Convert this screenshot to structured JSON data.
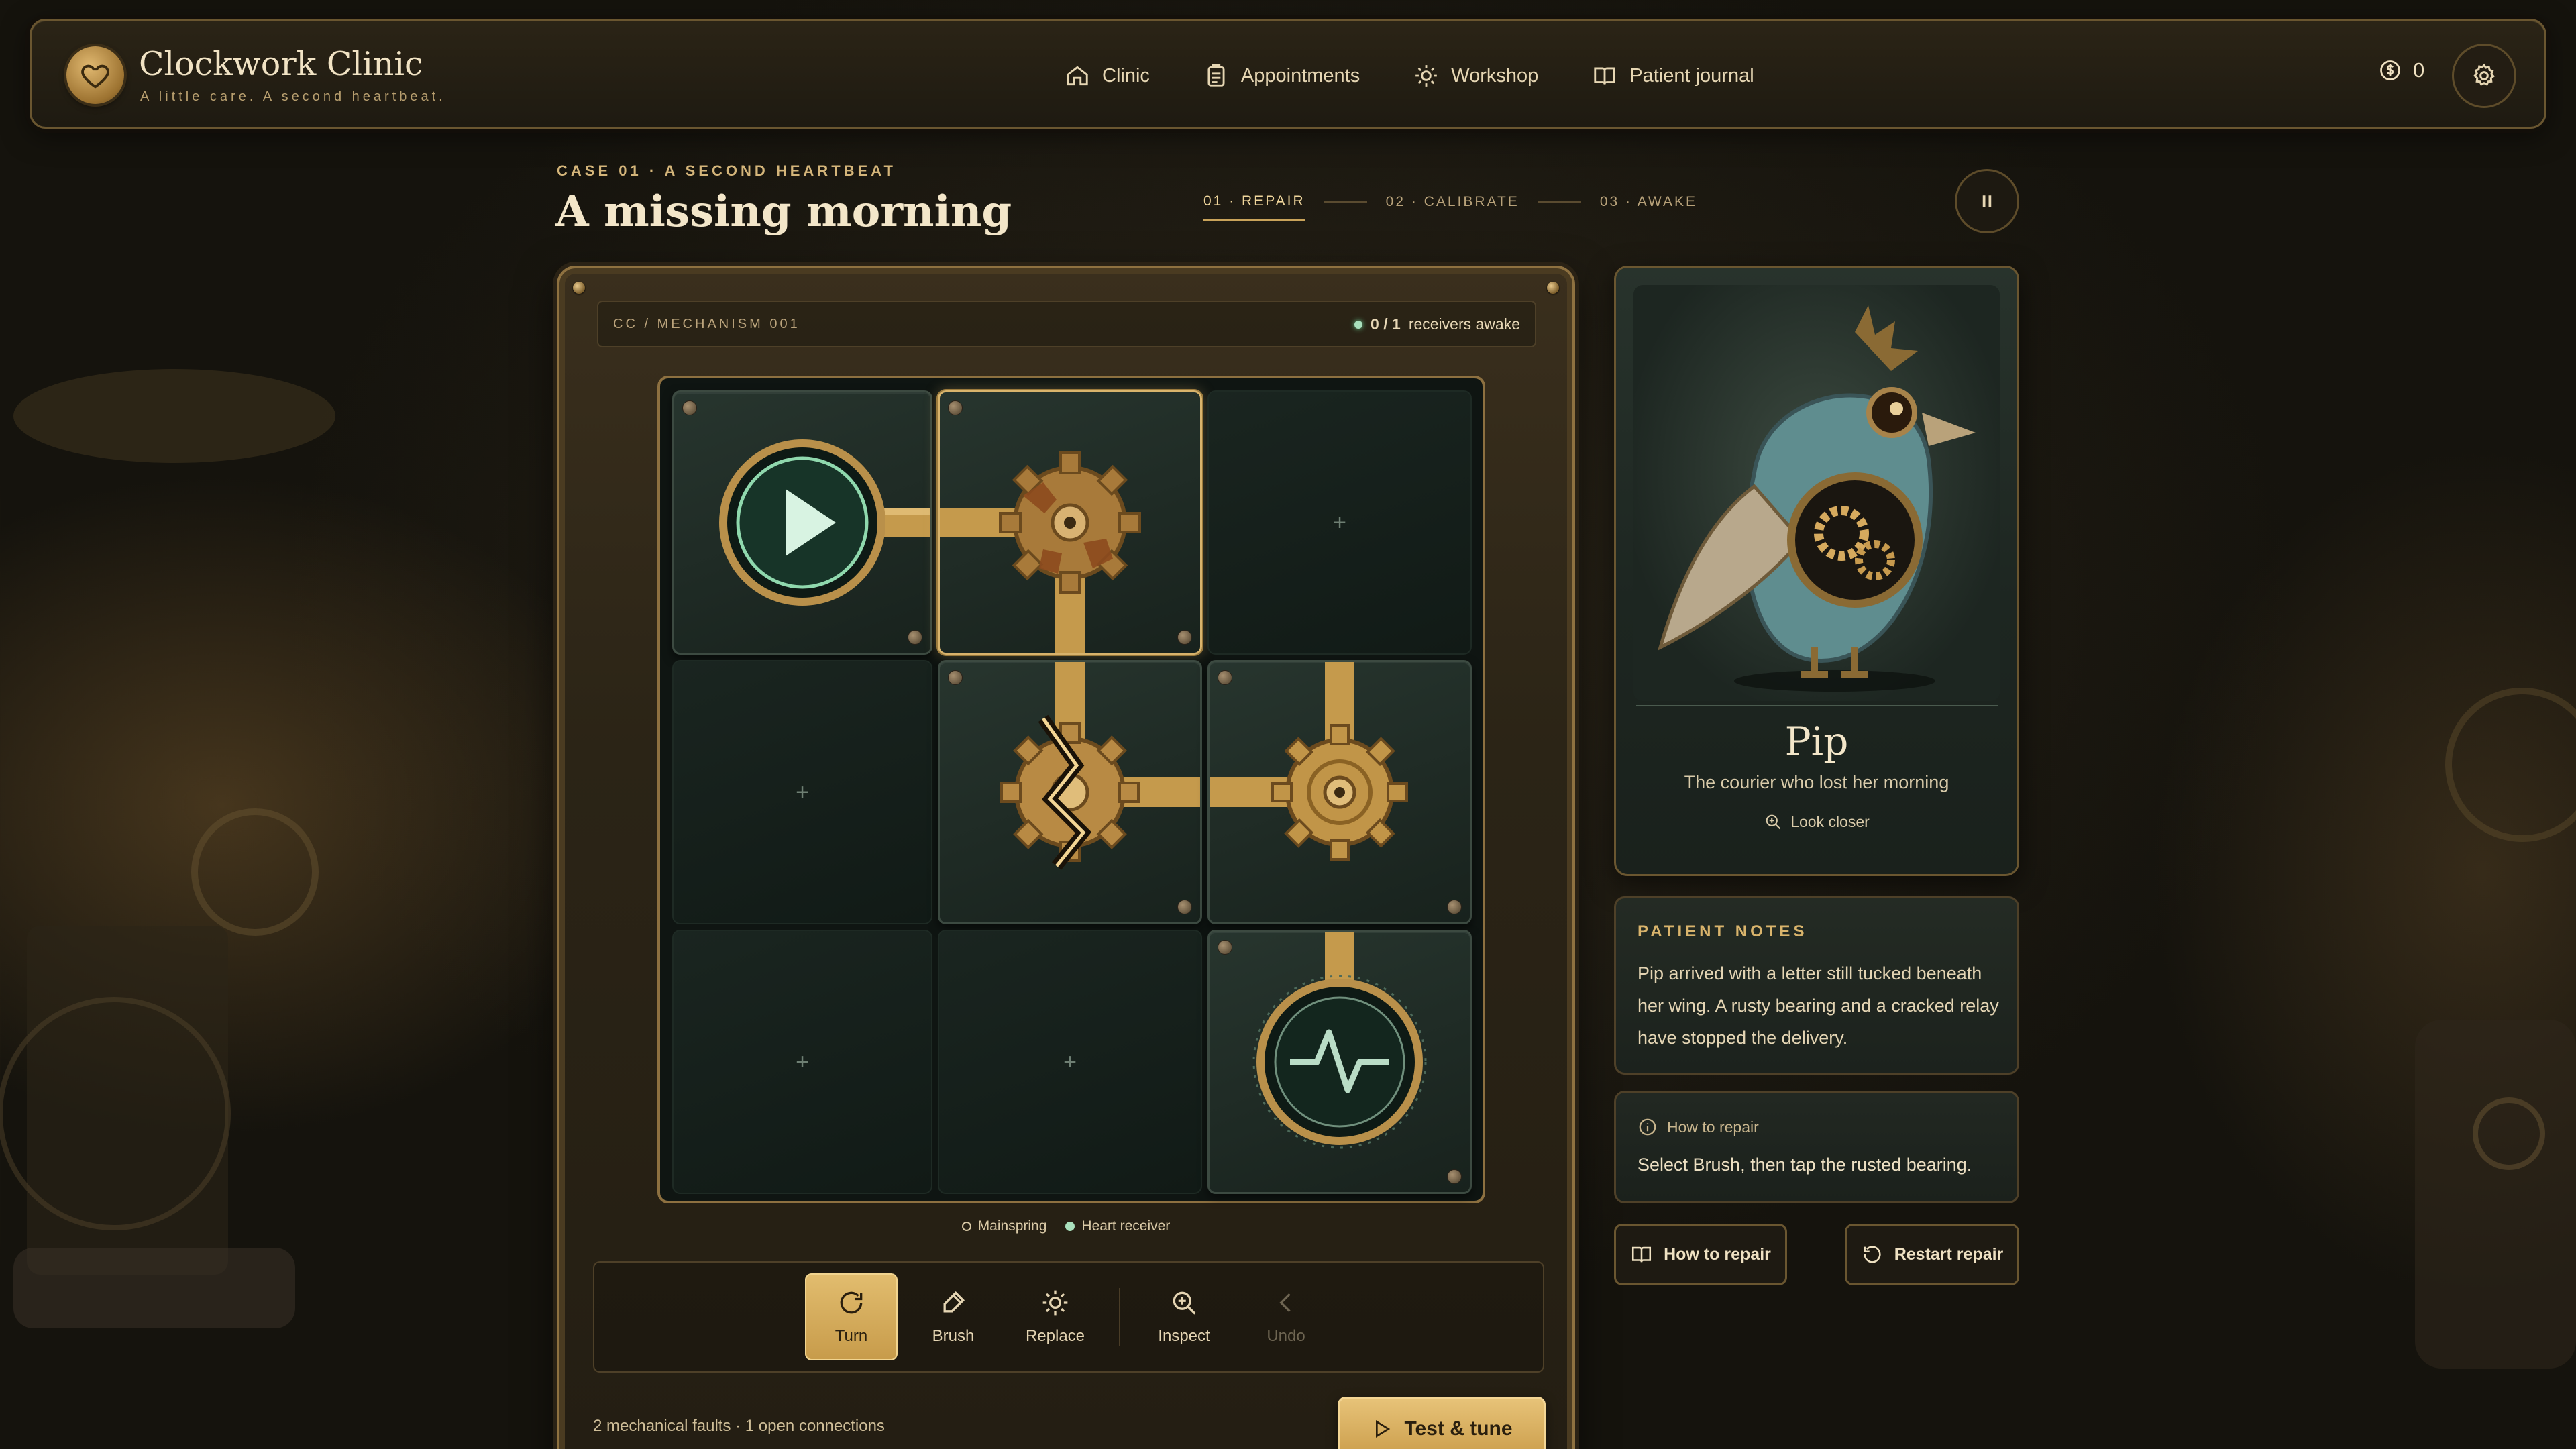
{
  "app": {
    "title": "Clockwork Clinic",
    "tagline": "A little care. A second heartbeat."
  },
  "nav": {
    "items": [
      {
        "label": "Clinic",
        "icon": "home-icon"
      },
      {
        "label": "Appointments",
        "icon": "clipboard-icon"
      },
      {
        "label": "Workshop",
        "icon": "gear-icon"
      },
      {
        "label": "Patient journal",
        "icon": "book-icon"
      }
    ],
    "coins": "0"
  },
  "case": {
    "kicker": "CASE 01 · A SECOND HEARTBEAT",
    "title": "A missing morning",
    "steps": [
      "01 · REPAIR",
      "02 · CALIBRATE",
      "03 · AWAKE"
    ],
    "active_step": 0
  },
  "board": {
    "code": "CC / MECHANISM 001",
    "receivers_count": "0 / 1",
    "receivers_label": "receivers awake",
    "grid": [
      [
        "mainspring",
        "rusted-gear",
        "empty"
      ],
      [
        "empty",
        "cracked-relay-gear",
        "gear"
      ],
      [
        "empty",
        "empty",
        "heart-receiver"
      ]
    ],
    "selected_cell": [
      0,
      1
    ],
    "legend": {
      "mainspring": "Mainspring",
      "receiver": "Heart receiver"
    },
    "tools": [
      {
        "label": "Turn",
        "icon": "rotate-icon",
        "state": "active"
      },
      {
        "label": "Brush",
        "icon": "brush-icon",
        "state": "normal"
      },
      {
        "label": "Replace",
        "icon": "gear-icon",
        "state": "normal"
      },
      {
        "label": "Inspect",
        "icon": "zoom-in-icon",
        "state": "normal"
      },
      {
        "label": "Undo",
        "icon": "chevron-left-icon",
        "state": "disabled"
      }
    ],
    "status": "2 mechanical faults · 1 open connections",
    "test_label": "Test & tune"
  },
  "patient": {
    "name": "Pip",
    "description": "The courier who lost her morning",
    "look_closer": "Look closer"
  },
  "notes": {
    "heading": "PATIENT NOTES",
    "body": "Pip arrived with a letter still tucked beneath her wing. A rusty bearing and a cracked relay have stopped the delivery."
  },
  "howto": {
    "heading": "How to repair",
    "body": "Select Brush, then tap the rusted bearing."
  },
  "buttons": {
    "how_to_repair": "How to repair",
    "restart": "Restart repair"
  },
  "colors": {
    "brass": "#c9a35a",
    "teal_glow": "#a9e0bd",
    "panel_dark": "#18221d"
  }
}
